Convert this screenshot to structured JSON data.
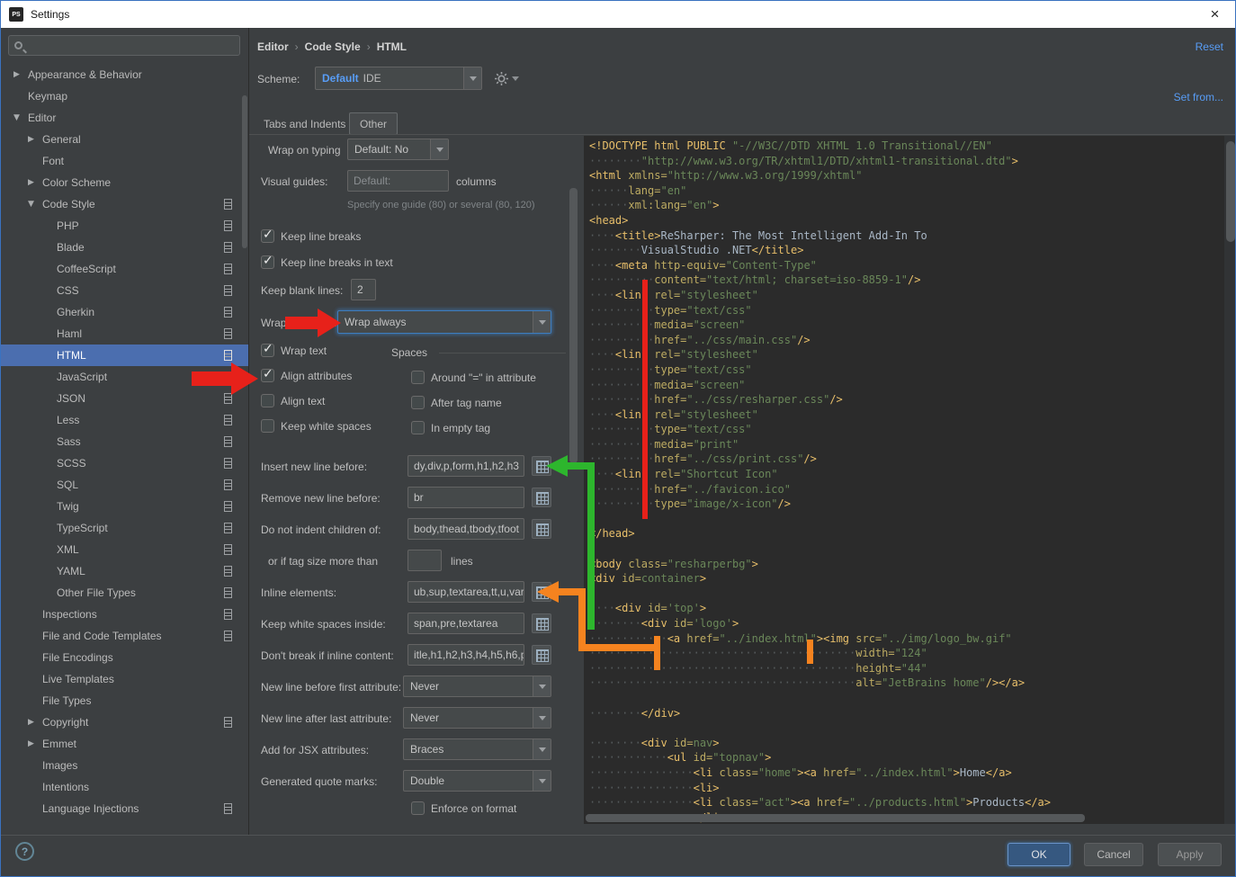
{
  "window": {
    "title": "Settings",
    "app_badge": "PS",
    "close_glyph": "×"
  },
  "colors": {
    "selection_blue": "#4b6eaf",
    "link_blue": "#589df6",
    "editor_bg": "#2b2b2b",
    "panel_bg": "#3c3f41"
  },
  "annotation_colors": {
    "red": "#e7211a",
    "green": "#2db62d",
    "orange": "#f5831f"
  },
  "sidebar": {
    "search_placeholder": "",
    "items": [
      {
        "label": "Appearance & Behavior",
        "level": 0,
        "arrow": "collapsed",
        "icon": false,
        "selected": false
      },
      {
        "label": "Keymap",
        "level": 0,
        "arrow": "none",
        "icon": false,
        "selected": false
      },
      {
        "label": "Editor",
        "level": 0,
        "arrow": "expanded",
        "icon": false,
        "selected": false
      },
      {
        "label": "General",
        "level": 1,
        "arrow": "collapsed",
        "icon": false,
        "selected": false
      },
      {
        "label": "Font",
        "level": 1,
        "arrow": "none",
        "icon": false,
        "selected": false
      },
      {
        "label": "Color Scheme",
        "level": 1,
        "arrow": "collapsed",
        "icon": false,
        "selected": false
      },
      {
        "label": "Code Style",
        "level": 1,
        "arrow": "expanded",
        "icon": true,
        "selected": false
      },
      {
        "label": "PHP",
        "level": 2,
        "arrow": "none",
        "icon": true,
        "selected": false
      },
      {
        "label": "Blade",
        "level": 2,
        "arrow": "none",
        "icon": true,
        "selected": false
      },
      {
        "label": "CoffeeScript",
        "level": 2,
        "arrow": "none",
        "icon": true,
        "selected": false
      },
      {
        "label": "CSS",
        "level": 2,
        "arrow": "none",
        "icon": true,
        "selected": false
      },
      {
        "label": "Gherkin",
        "level": 2,
        "arrow": "none",
        "icon": true,
        "selected": false
      },
      {
        "label": "Haml",
        "level": 2,
        "arrow": "none",
        "icon": true,
        "selected": false
      },
      {
        "label": "HTML",
        "level": 2,
        "arrow": "none",
        "icon": true,
        "selected": true
      },
      {
        "label": "JavaScript",
        "level": 2,
        "arrow": "none",
        "icon": true,
        "selected": false
      },
      {
        "label": "JSON",
        "level": 2,
        "arrow": "none",
        "icon": true,
        "selected": false
      },
      {
        "label": "Less",
        "level": 2,
        "arrow": "none",
        "icon": true,
        "selected": false
      },
      {
        "label": "Sass",
        "level": 2,
        "arrow": "none",
        "icon": true,
        "selected": false
      },
      {
        "label": "SCSS",
        "level": 2,
        "arrow": "none",
        "icon": true,
        "selected": false
      },
      {
        "label": "SQL",
        "level": 2,
        "arrow": "none",
        "icon": true,
        "selected": false
      },
      {
        "label": "Twig",
        "level": 2,
        "arrow": "none",
        "icon": true,
        "selected": false
      },
      {
        "label": "TypeScript",
        "level": 2,
        "arrow": "none",
        "icon": true,
        "selected": false
      },
      {
        "label": "XML",
        "level": 2,
        "arrow": "none",
        "icon": true,
        "selected": false
      },
      {
        "label": "YAML",
        "level": 2,
        "arrow": "none",
        "icon": true,
        "selected": false
      },
      {
        "label": "Other File Types",
        "level": 2,
        "arrow": "none",
        "icon": true,
        "selected": false
      },
      {
        "label": "Inspections",
        "level": 1,
        "arrow": "none",
        "icon": true,
        "selected": false
      },
      {
        "label": "File and Code Templates",
        "level": 1,
        "arrow": "none",
        "icon": true,
        "selected": false
      },
      {
        "label": "File Encodings",
        "level": 1,
        "arrow": "none",
        "icon": false,
        "selected": false
      },
      {
        "label": "Live Templates",
        "level": 1,
        "arrow": "none",
        "icon": false,
        "selected": false
      },
      {
        "label": "File Types",
        "level": 1,
        "arrow": "none",
        "icon": false,
        "selected": false
      },
      {
        "label": "Copyright",
        "level": 1,
        "arrow": "collapsed",
        "icon": true,
        "selected": false
      },
      {
        "label": "Emmet",
        "level": 1,
        "arrow": "collapsed",
        "icon": false,
        "selected": false
      },
      {
        "label": "Images",
        "level": 1,
        "arrow": "none",
        "icon": false,
        "selected": false
      },
      {
        "label": "Intentions",
        "level": 1,
        "arrow": "none",
        "icon": false,
        "selected": false
      },
      {
        "label": "Language Injections",
        "level": 1,
        "arrow": "none",
        "icon": true,
        "selected": false
      }
    ]
  },
  "header": {
    "breadcrumb": [
      "Editor",
      "Code Style",
      "HTML"
    ],
    "separator": "›",
    "reset": "Reset",
    "scheme_label": "Scheme:",
    "scheme_primary": "Default",
    "scheme_secondary": "IDE",
    "set_from": "Set from..."
  },
  "tabs": {
    "tab1": "Tabs and Indents",
    "tab2": "Other"
  },
  "form": {
    "wrap_on_typing": {
      "label": "Wrap on typing",
      "value": "Default: No"
    },
    "visual_guides": {
      "label": "Visual guides:",
      "value": "Default:",
      "suffix": "columns",
      "hint": "Specify one guide (80) or several (80, 120)"
    },
    "keep_line_breaks": {
      "label": "Keep line breaks",
      "checked": true
    },
    "keep_line_breaks_in_text": {
      "label": "Keep line breaks in text",
      "checked": true
    },
    "keep_blank_lines": {
      "label": "Keep blank lines:",
      "value": "2"
    },
    "wrap_attributes": {
      "label": "Wrap attributes:",
      "value": "Wrap always"
    },
    "wrap_text": {
      "label": "Wrap text",
      "checked": true
    },
    "spaces_header": "Spaces",
    "align_attributes": {
      "label": "Align attributes",
      "checked": true
    },
    "around_equals": {
      "label": "Around \"=\" in attribute",
      "checked": false
    },
    "align_text": {
      "label": "Align text",
      "checked": false
    },
    "after_tag_name": {
      "label": "After tag name",
      "checked": false
    },
    "keep_white_spaces": {
      "label": "Keep white spaces",
      "checked": false
    },
    "in_empty_tag": {
      "label": "In empty tag",
      "checked": false
    },
    "insert_new_line_before": {
      "label": "Insert new line before:",
      "value": "dy,div,p,form,h1,h2,h3"
    },
    "remove_new_line_before": {
      "label": "Remove new line before:",
      "value": "br"
    },
    "do_not_indent_children": {
      "label": "Do not indent children of:",
      "value": "body,thead,tbody,tfoot"
    },
    "or_if_tag_size": {
      "label": "or if tag size more than",
      "value": "",
      "suffix": "lines"
    },
    "inline_elements": {
      "label": "Inline elements:",
      "value": "ub,sup,textarea,tt,u,var"
    },
    "keep_white_spaces_inside": {
      "label": "Keep white spaces inside:",
      "value": "span,pre,textarea"
    },
    "dont_break_if_inline": {
      "label": "Don't break if inline content:",
      "value": "itle,h1,h2,h3,h4,h5,h6,p"
    },
    "new_line_before_first_attr": {
      "label": "New line before first attribute:",
      "value": "Never"
    },
    "new_line_after_last_attr": {
      "label": "New line after last attribute:",
      "value": "Never"
    },
    "jsx_attributes": {
      "label": "Add for JSX attributes:",
      "value": "Braces"
    },
    "generated_quote_marks": {
      "label": "Generated quote marks:",
      "value": "Double"
    },
    "enforce_on_format": {
      "label": "Enforce on format",
      "checked": false
    }
  },
  "preview": {
    "lines": [
      [
        [
          "t",
          "<!DOCTYPE html PUBLIC "
        ],
        [
          "s",
          "\"-//W3C//DTD XHTML 1.0 Transitional//EN\""
        ]
      ],
      [
        [
          "d",
          8
        ],
        [
          "s",
          "\"http://www.w3.org/TR/xhtml1/DTD/xhtml1-transitional.dtd\""
        ],
        [
          "t",
          ">"
        ]
      ],
      [
        [
          "t",
          "<html "
        ],
        [
          "a",
          "xmlns="
        ],
        [
          "s",
          "\"http://www.w3.org/1999/xhtml\""
        ]
      ],
      [
        [
          "d",
          6
        ],
        [
          "a",
          "lang="
        ],
        [
          "s",
          "\"en\""
        ]
      ],
      [
        [
          "d",
          6
        ],
        [
          "a",
          "xml:lang="
        ],
        [
          "s",
          "\"en\""
        ],
        [
          "t",
          ">"
        ]
      ],
      [
        [
          "t",
          "<head>"
        ]
      ],
      [
        [
          "d",
          4
        ],
        [
          "t",
          "<title>"
        ],
        [
          "x",
          "ReSharper: The Most Intelligent Add-In To"
        ]
      ],
      [
        [
          "d",
          8
        ],
        [
          "x",
          "VisualStudio .NET"
        ],
        [
          "t",
          "</title>"
        ]
      ],
      [
        [
          "d",
          4
        ],
        [
          "t",
          "<meta "
        ],
        [
          "a",
          "http-equiv="
        ],
        [
          "s",
          "\"Content-Type\""
        ]
      ],
      [
        [
          "d",
          10
        ],
        [
          "a",
          "content="
        ],
        [
          "s",
          "\"text/html; charset=iso-8859-1\""
        ],
        [
          "t",
          "/>"
        ]
      ],
      [
        [
          "d",
          4
        ],
        [
          "t",
          "<link "
        ],
        [
          "a",
          "rel="
        ],
        [
          "s",
          "\"stylesheet\""
        ]
      ],
      [
        [
          "d",
          10
        ],
        [
          "a",
          "type="
        ],
        [
          "s",
          "\"text/css\""
        ]
      ],
      [
        [
          "d",
          10
        ],
        [
          "a",
          "media="
        ],
        [
          "s",
          "\"screen\""
        ]
      ],
      [
        [
          "d",
          10
        ],
        [
          "a",
          "href="
        ],
        [
          "s",
          "\"../css/main.css\""
        ],
        [
          "t",
          "/>"
        ]
      ],
      [
        [
          "d",
          4
        ],
        [
          "t",
          "<link "
        ],
        [
          "a",
          "rel="
        ],
        [
          "s",
          "\"stylesheet\""
        ]
      ],
      [
        [
          "d",
          10
        ],
        [
          "a",
          "type="
        ],
        [
          "s",
          "\"text/css\""
        ]
      ],
      [
        [
          "d",
          10
        ],
        [
          "a",
          "media="
        ],
        [
          "s",
          "\"screen\""
        ]
      ],
      [
        [
          "d",
          10
        ],
        [
          "a",
          "href="
        ],
        [
          "s",
          "\"../css/resharper.css\""
        ],
        [
          "t",
          "/>"
        ]
      ],
      [
        [
          "d",
          4
        ],
        [
          "t",
          "<link "
        ],
        [
          "a",
          "rel="
        ],
        [
          "s",
          "\"stylesheet\""
        ]
      ],
      [
        [
          "d",
          10
        ],
        [
          "a",
          "type="
        ],
        [
          "s",
          "\"text/css\""
        ]
      ],
      [
        [
          "d",
          10
        ],
        [
          "a",
          "media="
        ],
        [
          "s",
          "\"print\""
        ]
      ],
      [
        [
          "d",
          10
        ],
        [
          "a",
          "href="
        ],
        [
          "s",
          "\"../css/print.css\""
        ],
        [
          "t",
          "/>"
        ]
      ],
      [
        [
          "d",
          4
        ],
        [
          "t",
          "<link "
        ],
        [
          "a",
          "rel="
        ],
        [
          "s",
          "\"Shortcut Icon\""
        ]
      ],
      [
        [
          "d",
          10
        ],
        [
          "a",
          "href="
        ],
        [
          "s",
          "\"../favicon.ico\""
        ]
      ],
      [
        [
          "d",
          10
        ],
        [
          "a",
          "type="
        ],
        [
          "s",
          "\"image/x-icon\""
        ],
        [
          "t",
          "/>"
        ]
      ],
      [],
      [
        [
          "t",
          "</head>"
        ]
      ],
      [],
      [
        [
          "t",
          "<body "
        ],
        [
          "a",
          "class="
        ],
        [
          "s",
          "\"resharperbg\""
        ],
        [
          "t",
          ">"
        ]
      ],
      [
        [
          "t",
          "<div "
        ],
        [
          "a",
          "id="
        ],
        [
          "s",
          "container"
        ],
        [
          "t",
          ">"
        ]
      ],
      [],
      [
        [
          "d",
          4
        ],
        [
          "t",
          "<div "
        ],
        [
          "a",
          "id="
        ],
        [
          "s",
          "'top'"
        ],
        [
          "t",
          ">"
        ]
      ],
      [
        [
          "d",
          8
        ],
        [
          "t",
          "<div "
        ],
        [
          "a",
          "id="
        ],
        [
          "s",
          "'logo'"
        ],
        [
          "t",
          ">"
        ]
      ],
      [
        [
          "d",
          12
        ],
        [
          "t",
          "<a "
        ],
        [
          "a",
          "href="
        ],
        [
          "s",
          "\"../index.html\""
        ],
        [
          "t",
          "><img "
        ],
        [
          "a",
          "src="
        ],
        [
          "s",
          "\"../img/logo_bw.gif\""
        ]
      ],
      [
        [
          "d",
          41
        ],
        [
          "a",
          "width="
        ],
        [
          "s",
          "\"124\""
        ]
      ],
      [
        [
          "d",
          41
        ],
        [
          "a",
          "height="
        ],
        [
          "s",
          "\"44\""
        ]
      ],
      [
        [
          "d",
          41
        ],
        [
          "a",
          "alt="
        ],
        [
          "s",
          "\"JetBrains home\""
        ],
        [
          "t",
          "/></a>"
        ]
      ],
      [],
      [
        [
          "d",
          8
        ],
        [
          "t",
          "</div>"
        ]
      ],
      [],
      [
        [
          "d",
          8
        ],
        [
          "t",
          "<div "
        ],
        [
          "a",
          "id="
        ],
        [
          "s",
          "nav"
        ],
        [
          "t",
          ">"
        ]
      ],
      [
        [
          "d",
          12
        ],
        [
          "t",
          "<ul "
        ],
        [
          "a",
          "id="
        ],
        [
          "s",
          "\"topnav\""
        ],
        [
          "t",
          ">"
        ]
      ],
      [
        [
          "d",
          16
        ],
        [
          "t",
          "<li "
        ],
        [
          "a",
          "class="
        ],
        [
          "s",
          "\"home\""
        ],
        [
          "t",
          "><a "
        ],
        [
          "a",
          "href="
        ],
        [
          "s",
          "\"../index.html\""
        ],
        [
          "t",
          ">"
        ],
        [
          "x",
          "Home"
        ],
        [
          "t",
          "</a>"
        ]
      ],
      [
        [
          "d",
          16
        ],
        [
          "t",
          "<li>"
        ]
      ],
      [
        [
          "d",
          16
        ],
        [
          "t",
          "<li "
        ],
        [
          "a",
          "class="
        ],
        [
          "s",
          "\"act\""
        ],
        [
          "t",
          "><a "
        ],
        [
          "a",
          "href="
        ],
        [
          "s",
          "\"../products.html\""
        ],
        [
          "t",
          ">"
        ],
        [
          "x",
          "Products"
        ],
        [
          "t",
          "</a>"
        ]
      ],
      [
        [
          "d",
          16
        ],
        [
          "t",
          "</li>"
        ]
      ]
    ]
  },
  "footer": {
    "ok": "OK",
    "cancel": "Cancel",
    "apply": "Apply",
    "help": "?"
  }
}
